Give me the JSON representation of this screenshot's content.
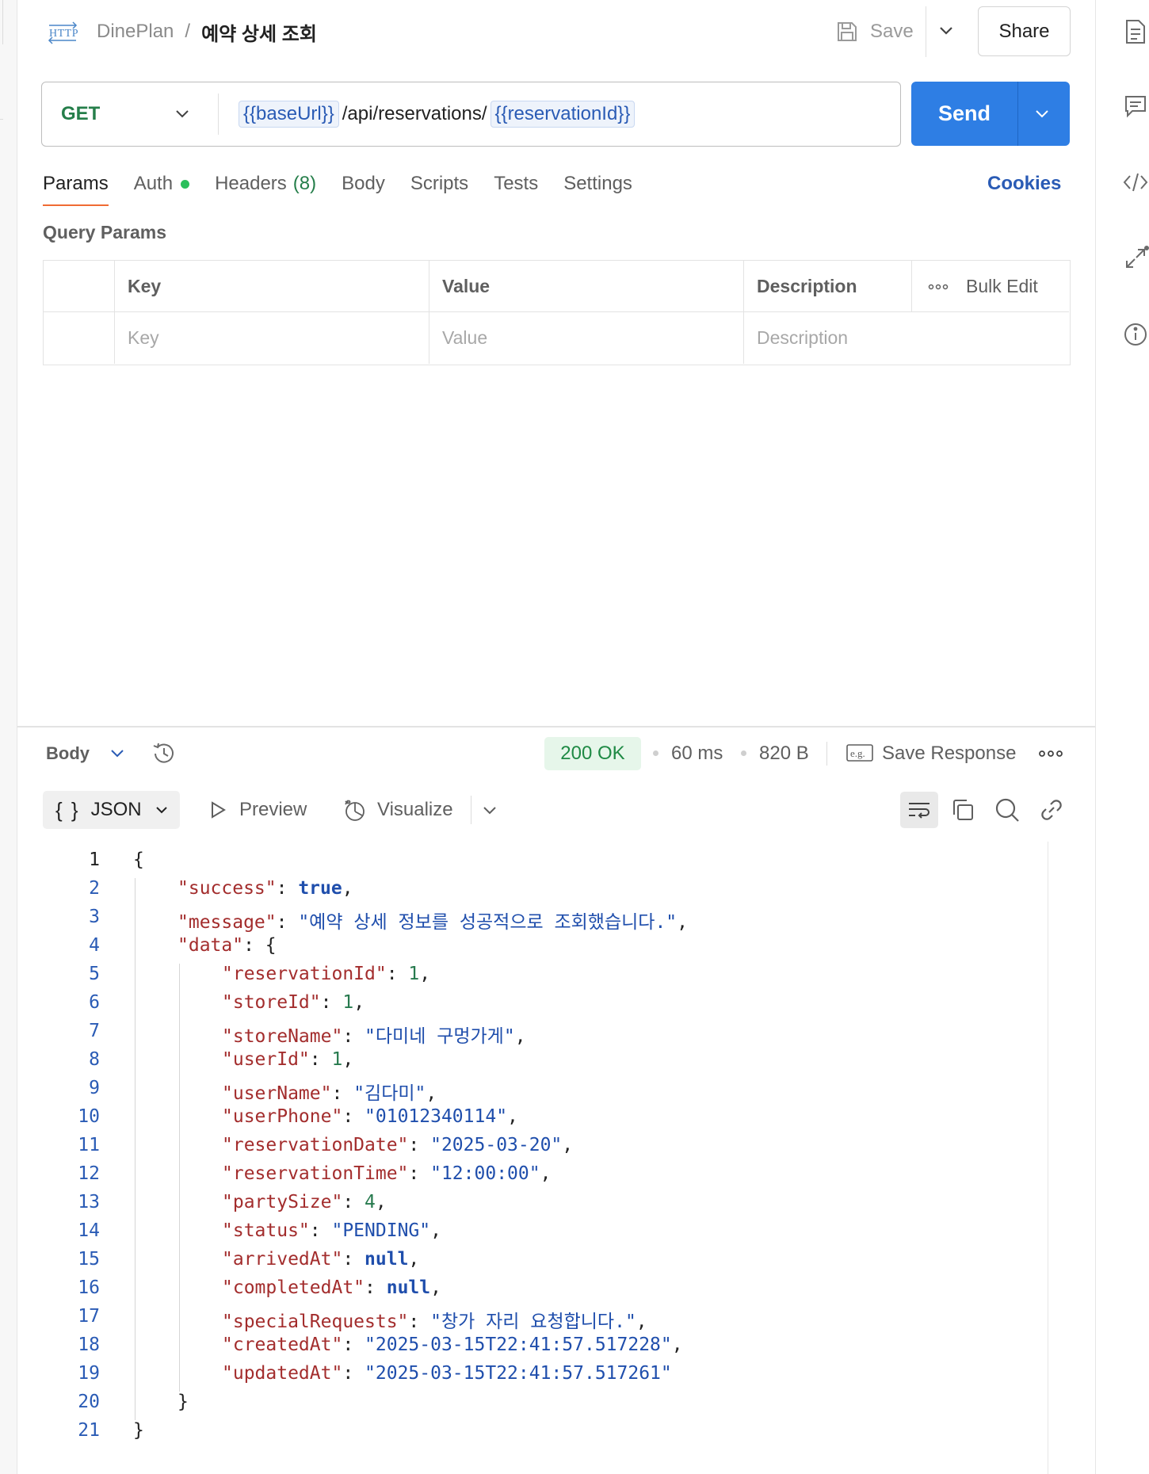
{
  "header": {
    "workspace": "DinePlan",
    "separator": "/",
    "request_title": "예약 상세 조회",
    "save_label": "Save",
    "share_label": "Share"
  },
  "request": {
    "method": "GET",
    "url_var1": "{{baseUrl}}",
    "url_path": "/api/reservations/",
    "url_var2": "{{reservationId}}",
    "send_label": "Send"
  },
  "tabs": {
    "params": "Params",
    "auth": "Auth",
    "headers": "Headers",
    "headers_count": "(8)",
    "body": "Body",
    "scripts": "Scripts",
    "tests": "Tests",
    "settings": "Settings",
    "cookies": "Cookies"
  },
  "query_params": {
    "label": "Query Params",
    "columns": [
      "Key",
      "Value",
      "Description"
    ],
    "bulk_edit": "Bulk Edit",
    "placeholders": [
      "Key",
      "Value",
      "Description"
    ]
  },
  "response": {
    "body_label": "Body",
    "status": "200 OK",
    "time": "60 ms",
    "size": "820 B",
    "save_response": "Save Response",
    "format": "JSON",
    "preview": "Preview",
    "visualize": "Visualize"
  },
  "code_lines": [
    [
      [
        "p",
        "{"
      ]
    ],
    [
      [
        "k",
        "\"success\""
      ],
      [
        "p",
        ": "
      ],
      [
        "b",
        "true"
      ],
      [
        "p",
        ","
      ]
    ],
    [
      [
        "k",
        "\"message\""
      ],
      [
        "p",
        ": "
      ],
      [
        "s",
        "\"예약 상세 정보를 성공적으로 조회했습니다.\""
      ],
      [
        "p",
        ","
      ]
    ],
    [
      [
        "k",
        "\"data\""
      ],
      [
        "p",
        ": {"
      ]
    ],
    [
      [
        "k",
        "\"reservationId\""
      ],
      [
        "p",
        ": "
      ],
      [
        "n",
        "1"
      ],
      [
        "p",
        ","
      ]
    ],
    [
      [
        "k",
        "\"storeId\""
      ],
      [
        "p",
        ": "
      ],
      [
        "n",
        "1"
      ],
      [
        "p",
        ","
      ]
    ],
    [
      [
        "k",
        "\"storeName\""
      ],
      [
        "p",
        ": "
      ],
      [
        "s",
        "\"다미네 구멍가게\""
      ],
      [
        "p",
        ","
      ]
    ],
    [
      [
        "k",
        "\"userId\""
      ],
      [
        "p",
        ": "
      ],
      [
        "n",
        "1"
      ],
      [
        "p",
        ","
      ]
    ],
    [
      [
        "k",
        "\"userName\""
      ],
      [
        "p",
        ": "
      ],
      [
        "s",
        "\"김다미\""
      ],
      [
        "p",
        ","
      ]
    ],
    [
      [
        "k",
        "\"userPhone\""
      ],
      [
        "p",
        ": "
      ],
      [
        "s",
        "\"01012340114\""
      ],
      [
        "p",
        ","
      ]
    ],
    [
      [
        "k",
        "\"reservationDate\""
      ],
      [
        "p",
        ": "
      ],
      [
        "s",
        "\"2025-03-20\""
      ],
      [
        "p",
        ","
      ]
    ],
    [
      [
        "k",
        "\"reservationTime\""
      ],
      [
        "p",
        ": "
      ],
      [
        "s",
        "\"12:00:00\""
      ],
      [
        "p",
        ","
      ]
    ],
    [
      [
        "k",
        "\"partySize\""
      ],
      [
        "p",
        ": "
      ],
      [
        "n",
        "4"
      ],
      [
        "p",
        ","
      ]
    ],
    [
      [
        "k",
        "\"status\""
      ],
      [
        "p",
        ": "
      ],
      [
        "s",
        "\"PENDING\""
      ],
      [
        "p",
        ","
      ]
    ],
    [
      [
        "k",
        "\"arrivedAt\""
      ],
      [
        "p",
        ": "
      ],
      [
        "b",
        "null"
      ],
      [
        "p",
        ","
      ]
    ],
    [
      [
        "k",
        "\"completedAt\""
      ],
      [
        "p",
        ": "
      ],
      [
        "b",
        "null"
      ],
      [
        "p",
        ","
      ]
    ],
    [
      [
        "k",
        "\"specialRequests\""
      ],
      [
        "p",
        ": "
      ],
      [
        "s",
        "\"창가 자리 요청합니다.\""
      ],
      [
        "p",
        ","
      ]
    ],
    [
      [
        "k",
        "\"createdAt\""
      ],
      [
        "p",
        ": "
      ],
      [
        "s",
        "\"2025-03-15T22:41:57.517228\""
      ],
      [
        "p",
        ","
      ]
    ],
    [
      [
        "k",
        "\"updatedAt\""
      ],
      [
        "p",
        ": "
      ],
      [
        "s",
        "\"2025-03-15T22:41:57.517261\""
      ]
    ],
    [
      [
        "p",
        "}"
      ]
    ],
    [
      [
        "p",
        "}"
      ]
    ]
  ],
  "code_indent": [
    0,
    1,
    1,
    1,
    2,
    2,
    2,
    2,
    2,
    2,
    2,
    2,
    2,
    2,
    2,
    2,
    2,
    2,
    2,
    1,
    0
  ],
  "colors": {
    "send": "#2e7ee4",
    "method": "#257e4a",
    "status_ok": "#1f8a45",
    "active_tab": "#f06b33",
    "json_key": "#a32d2d",
    "json_string": "#1f4eac",
    "json_number": "#277a4e"
  },
  "icons": [
    "http-icon",
    "save-icon",
    "chevron-down-icon",
    "history-icon",
    "example-icon",
    "more-icon",
    "braces-icon",
    "play-icon",
    "visualize-icon",
    "wrap-icon",
    "copy-icon",
    "search-icon",
    "link-icon",
    "docs-icon",
    "comments-icon",
    "code-icon",
    "related-icon",
    "info-icon"
  ]
}
